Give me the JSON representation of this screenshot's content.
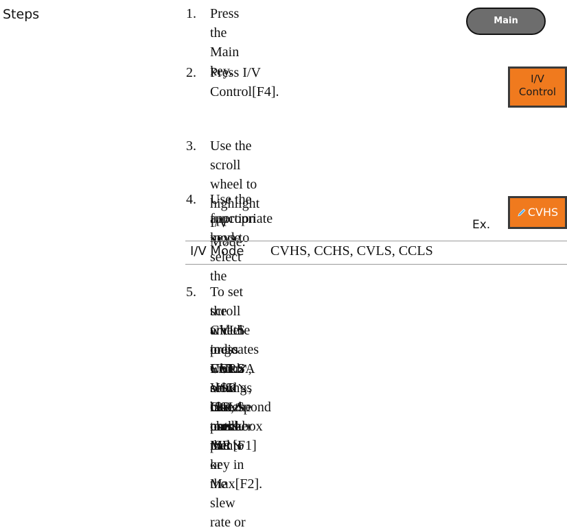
{
  "section_label": "Steps",
  "steps": [
    {
      "num": "1.",
      "lines": [
        "Press the Main key."
      ]
    },
    {
      "num": "2.",
      "lines": [
        "Press I/V Control[F4]."
      ]
    },
    {
      "num": "3.",
      "lines": [
        "Use the scroll wheel to highlight I/V Mode."
      ]
    },
    {
      "num": "4.",
      "lines": [
        "Use the function keys to select the",
        "appropriate mode."
      ]
    },
    {
      "num": "5.",
      "lines": [
        "To set the CVLS or CCLS slew rate, use the",
        "scroll wheel to go VSR↗, VSR↘, ISR↗ or ISR↘",
        "and the press Enter. A solid blue checkbox",
        "indicates which settings correspond to the",
        "CVLS or CCLS mode.",
        "",
        "Use the number pad to key in the slew rate or",
        "press Min[F1] or Max[F2]."
      ]
    }
  ],
  "keys": {
    "main": "Main",
    "iv_control_line1": "I/V",
    "iv_control_line2": "Control",
    "cvhs": "CVHS",
    "example_label": "Ex."
  },
  "mode_table": {
    "label": "I/V Mode",
    "value": "CVHS, CCHS, CVLS, CCLS"
  },
  "colors": {
    "key_orange": "#f07a1e",
    "main_key_gray": "#6d6d6d",
    "pencil_blue": "#4aa8e8"
  }
}
